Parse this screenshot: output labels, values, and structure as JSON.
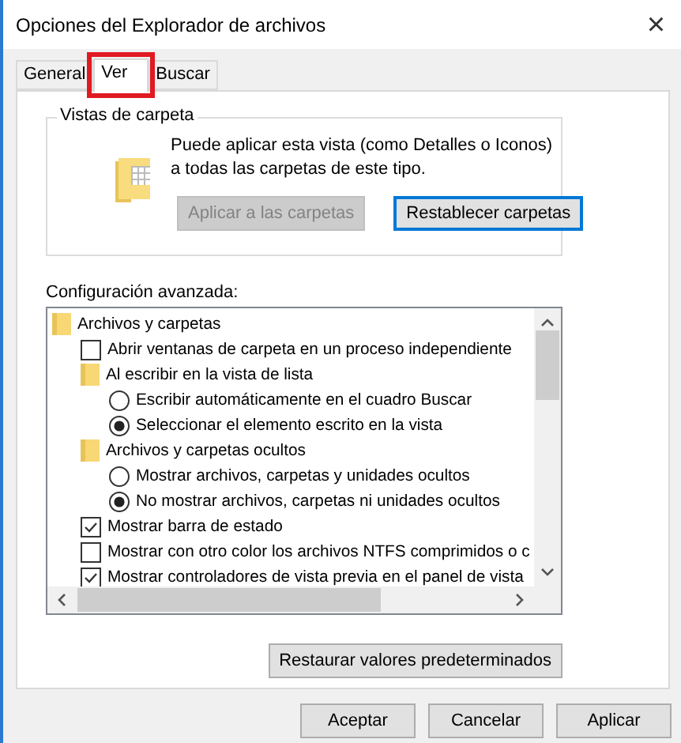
{
  "window": {
    "title": "Opciones del Explorador de archivos",
    "close": "×"
  },
  "tabs": [
    {
      "label": "General",
      "selected": false,
      "highlighted": false
    },
    {
      "label": "Ver",
      "selected": true,
      "highlighted": true
    },
    {
      "label": "Buscar",
      "selected": false,
      "highlighted": false
    }
  ],
  "folder_views": {
    "title": "Vistas de carpeta",
    "description": "Puede aplicar esta vista (como Detalles o Iconos) a todas las carpetas de este tipo.",
    "buttons": [
      {
        "label": "Aplicar a las carpetas",
        "disabled": true,
        "focused": false
      },
      {
        "label": "Restablecer carpetas",
        "disabled": false,
        "focused": true
      }
    ]
  },
  "advanced": {
    "label": "Configuración avanzada:",
    "items": [
      {
        "kind": "folder",
        "label": "Archivos y carpetas",
        "children": [
          {
            "kind": "checkbox",
            "label": "Abrir ventanas de carpeta  en un proceso independiente",
            "checked": false
          },
          {
            "kind": "folder",
            "label": "Al escribir en la vista de lista",
            "children": [
              {
                "kind": "radio",
                "label": "Escribir automáticamente en el cuadro Buscar",
                "checked": false
              },
              {
                "kind": "radio",
                "label": "Seleccionar el elemento escrito en la vista",
                "checked": true
              }
            ]
          },
          {
            "kind": "folder",
            "label": "Archivos y carpetas ocultos",
            "children": [
              {
                "kind": "radio",
                "label": "Mostrar archivos, carpetas y unidades ocultos",
                "checked": false
              },
              {
                "kind": "radio",
                "label": "No mostrar archivos, carpetas ni unidades ocultos",
                "checked": true
              }
            ]
          },
          {
            "kind": "checkbox",
            "label": "Mostrar barra de estado",
            "checked": true
          },
          {
            "kind": "checkbox",
            "label": "Mostrar con otro color los archivos NTFS comprimidos o c",
            "checked": false
          },
          {
            "kind": "checkbox",
            "label": "Mostrar controladores de vista previa en el panel de vista",
            "checked": true
          }
        ]
      }
    ]
  },
  "restore_button": "Restaurar valores predeterminados",
  "buttons": [
    "Aceptar",
    "Cancelar",
    "Aplicar"
  ]
}
